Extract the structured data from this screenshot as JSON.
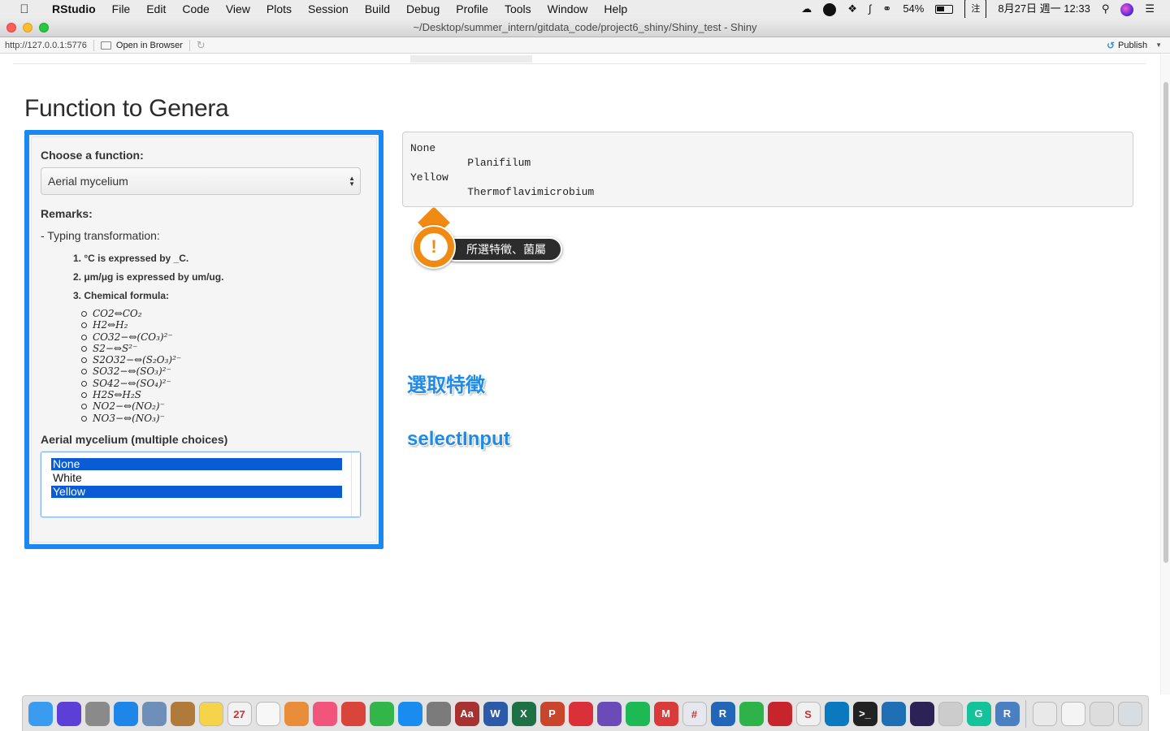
{
  "menubar": {
    "app_name": "RStudio",
    "menus": [
      "File",
      "Edit",
      "Code",
      "View",
      "Plots",
      "Session",
      "Build",
      "Debug",
      "Profile",
      "Tools",
      "Window",
      "Help"
    ],
    "battery": "54%",
    "ime_label": "注",
    "datetime": "8月27日 週一 12:33"
  },
  "window": {
    "title": "~/Desktop/summer_intern/gitdata_code/project6_shiny/Shiny_test - Shiny"
  },
  "viewer_toolbar": {
    "url": "http://127.0.0.1:5776",
    "open_in_browser": "Open in Browser",
    "publish": "Publish"
  },
  "app": {
    "title": "Function to Genera",
    "function_label": "Choose a function:",
    "function_selected": "Aerial mycelium",
    "remarks_label": "Remarks:",
    "remark_line": "- Typing transformation:",
    "remark_items": [
      "1. °C is expressed by _C.",
      "2. μm/μg is expressed by um/ug.",
      "3. Chemical formula:"
    ],
    "formulas": [
      "CO2⇔CO₂",
      "H2⇔H₂",
      "CO32−⇔(CO₃)²⁻",
      "S2−⇔S²⁻",
      "S2O32−⇔(S₂O₃)²⁻",
      "SO32−⇔(SO₃)²⁻",
      "SO42−⇔(SO₄)²⁻",
      "H2S⇔H₂S",
      "NO2−⇔(NO₂)⁻",
      "NO3−⇔(NO₃)⁻"
    ],
    "multi_label": "Aerial mycelium (multiple choices)",
    "options": [
      {
        "label": "None",
        "selected": true
      },
      {
        "label": "White",
        "selected": false
      },
      {
        "label": "Yellow",
        "selected": true
      }
    ],
    "output_text": "None\n         Planifilum\nYellow\n         Thermoflavimicrobium"
  },
  "annotations": {
    "callout": "所選特徵、菌屬",
    "callout_icon": "!",
    "select_feature": "選取特徵",
    "select_input": "selectInput"
  },
  "colors": {
    "sidebar_border": "#1a88f2",
    "selected_option": "#0a5bd6",
    "callout_orange": "#f08a12",
    "annotation_blue": "#1f8be8"
  },
  "dock": {
    "apps": [
      {
        "icon": "finder-icon",
        "color": "#3a9cf0",
        "label": ""
      },
      {
        "icon": "siri-icon",
        "color": "#5b3fd6",
        "label": ""
      },
      {
        "icon": "launchpad-icon",
        "color": "#8a8a8a",
        "label": ""
      },
      {
        "icon": "safari-icon",
        "color": "#1d86e8",
        "label": ""
      },
      {
        "icon": "preview-icon",
        "color": "#6d8fb8",
        "label": ""
      },
      {
        "icon": "notefile-icon",
        "color": "#b07a3a",
        "label": ""
      },
      {
        "icon": "notes-icon",
        "color": "#f5d44a",
        "label": ""
      },
      {
        "icon": "calendar-icon",
        "color": "#f2f2f2",
        "label": "27"
      },
      {
        "icon": "reminders-icon",
        "color": "#f7f7f7",
        "label": ""
      },
      {
        "icon": "photos-icon",
        "color": "#e98d3a",
        "label": ""
      },
      {
        "icon": "itunes-icon",
        "color": "#f2557c",
        "label": ""
      },
      {
        "icon": "chrome-icon",
        "color": "#d9453a",
        "label": ""
      },
      {
        "icon": "line-icon",
        "color": "#32b64a",
        "label": ""
      },
      {
        "icon": "app-store-icon",
        "color": "#1a8cf0",
        "label": ""
      },
      {
        "icon": "system-preferences-icon",
        "color": "#7b7b7b",
        "label": ""
      },
      {
        "icon": "dictionary-icon",
        "color": "#a83232",
        "label": "Aa"
      },
      {
        "icon": "word-icon",
        "color": "#2b5ba8",
        "label": "W"
      },
      {
        "icon": "excel-icon",
        "color": "#1e7145",
        "label": "X"
      },
      {
        "icon": "powerpoint-icon",
        "color": "#c9462c",
        "label": "P"
      },
      {
        "icon": "pdf-icon",
        "color": "#d9303a",
        "label": ""
      },
      {
        "icon": "djview-icon",
        "color": "#6a4bb8",
        "label": ""
      },
      {
        "icon": "spotify-icon",
        "color": "#1db954",
        "label": ""
      },
      {
        "icon": "mail-icon",
        "color": "#d93a3a",
        "label": "M"
      },
      {
        "icon": "slack-icon",
        "color": "#e7e7f0",
        "label": "#"
      },
      {
        "icon": "r-icon",
        "color": "#2266b8",
        "label": "R"
      },
      {
        "icon": "evernote-icon",
        "color": "#2db34a",
        "label": ""
      },
      {
        "icon": "mendeley-icon",
        "color": "#c8242b",
        "label": ""
      },
      {
        "icon": "scrivener-icon",
        "color": "#f0f0f0",
        "label": "S"
      },
      {
        "icon": "trello-icon",
        "color": "#0a79bf",
        "label": ""
      },
      {
        "icon": "terminal-icon",
        "color": "#222222",
        "label": ">_"
      },
      {
        "icon": "vscode-icon",
        "color": "#1f6fb5",
        "label": ""
      },
      {
        "icon": "eclipse-icon",
        "color": "#2c2255",
        "label": ""
      },
      {
        "icon": "ntfs-icon",
        "color": "#cccccc",
        "label": ""
      },
      {
        "icon": "grammarly-icon",
        "color": "#15c39a",
        "label": "G"
      },
      {
        "icon": "rstudio-icon",
        "color": "#4a7fc1",
        "label": "R"
      }
    ],
    "right_items": [
      {
        "icon": "folder-stack-icon",
        "color": "#e9e9e9"
      },
      {
        "icon": "downloads-stack-icon",
        "color": "#f4f4f4"
      },
      {
        "icon": "python-stack-icon",
        "color": "#dddddd"
      },
      {
        "icon": "trash-icon",
        "color": "#d8dde2"
      }
    ]
  }
}
